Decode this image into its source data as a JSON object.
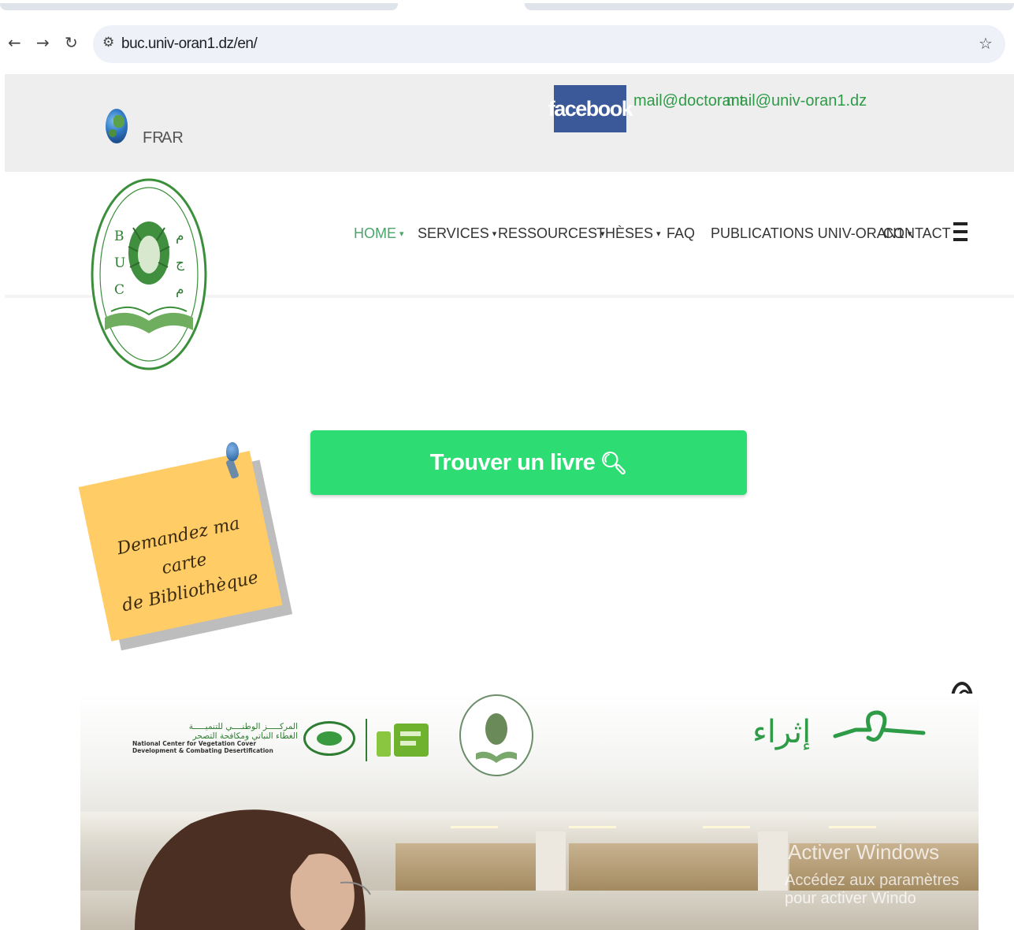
{
  "browser": {
    "url": "buc.univ-oran1.dz/en/",
    "icons": [
      "back-arrow-icon",
      "forward-arrow-icon",
      "reload-icon",
      "site-settings-icon",
      "bookmark-star-icon"
    ]
  },
  "topbar": {
    "lang_fr": "FR",
    "lang_ar": "AR",
    "facebook_label": "facebook",
    "mail_doctorant": "mail@doctorant",
    "mail_univ": "mail@univ-oran1.dz"
  },
  "logo": {
    "letters_left": [
      "B",
      "U",
      "C"
    ],
    "letters_right": [
      "م",
      "ج",
      "م"
    ]
  },
  "nav": {
    "items": [
      {
        "label": "HOME",
        "dropdown": true,
        "active": true
      },
      {
        "label": "SERVICES",
        "dropdown": true
      },
      {
        "label": "RESSOURCES",
        "dropdown": true
      },
      {
        "label": "THÈSES",
        "dropdown": true
      },
      {
        "label": "FAQ",
        "dropdown": false
      },
      {
        "label": "PUBLICATIONS UNIV-ORAN1",
        "dropdown": true
      },
      {
        "label": "CONTACT",
        "dropdown": false
      }
    ],
    "active_color": "#4aa56a"
  },
  "cta": {
    "find_book_label": "Trouver un livre",
    "color": "#2ddd73"
  },
  "sticky_note": {
    "line1": "Demandez ma carte",
    "line2": "de Bibliothèque",
    "color": "#ffcc66"
  },
  "banner": {
    "center_ar_line1": "المركـــــز الوطنــــي للتنميـــــة",
    "center_ar_line2": "الغطاء النباتي ومكافحة التصحر",
    "center_en_line1": "National Center for Vegetation Cover",
    "center_en_line2": "Development & Combating Desertification",
    "enrich_ar": "إثراء",
    "watermark_line1": "Activer Windows",
    "watermark_line2": "Accédez aux paramètres pour activer Windo"
  }
}
